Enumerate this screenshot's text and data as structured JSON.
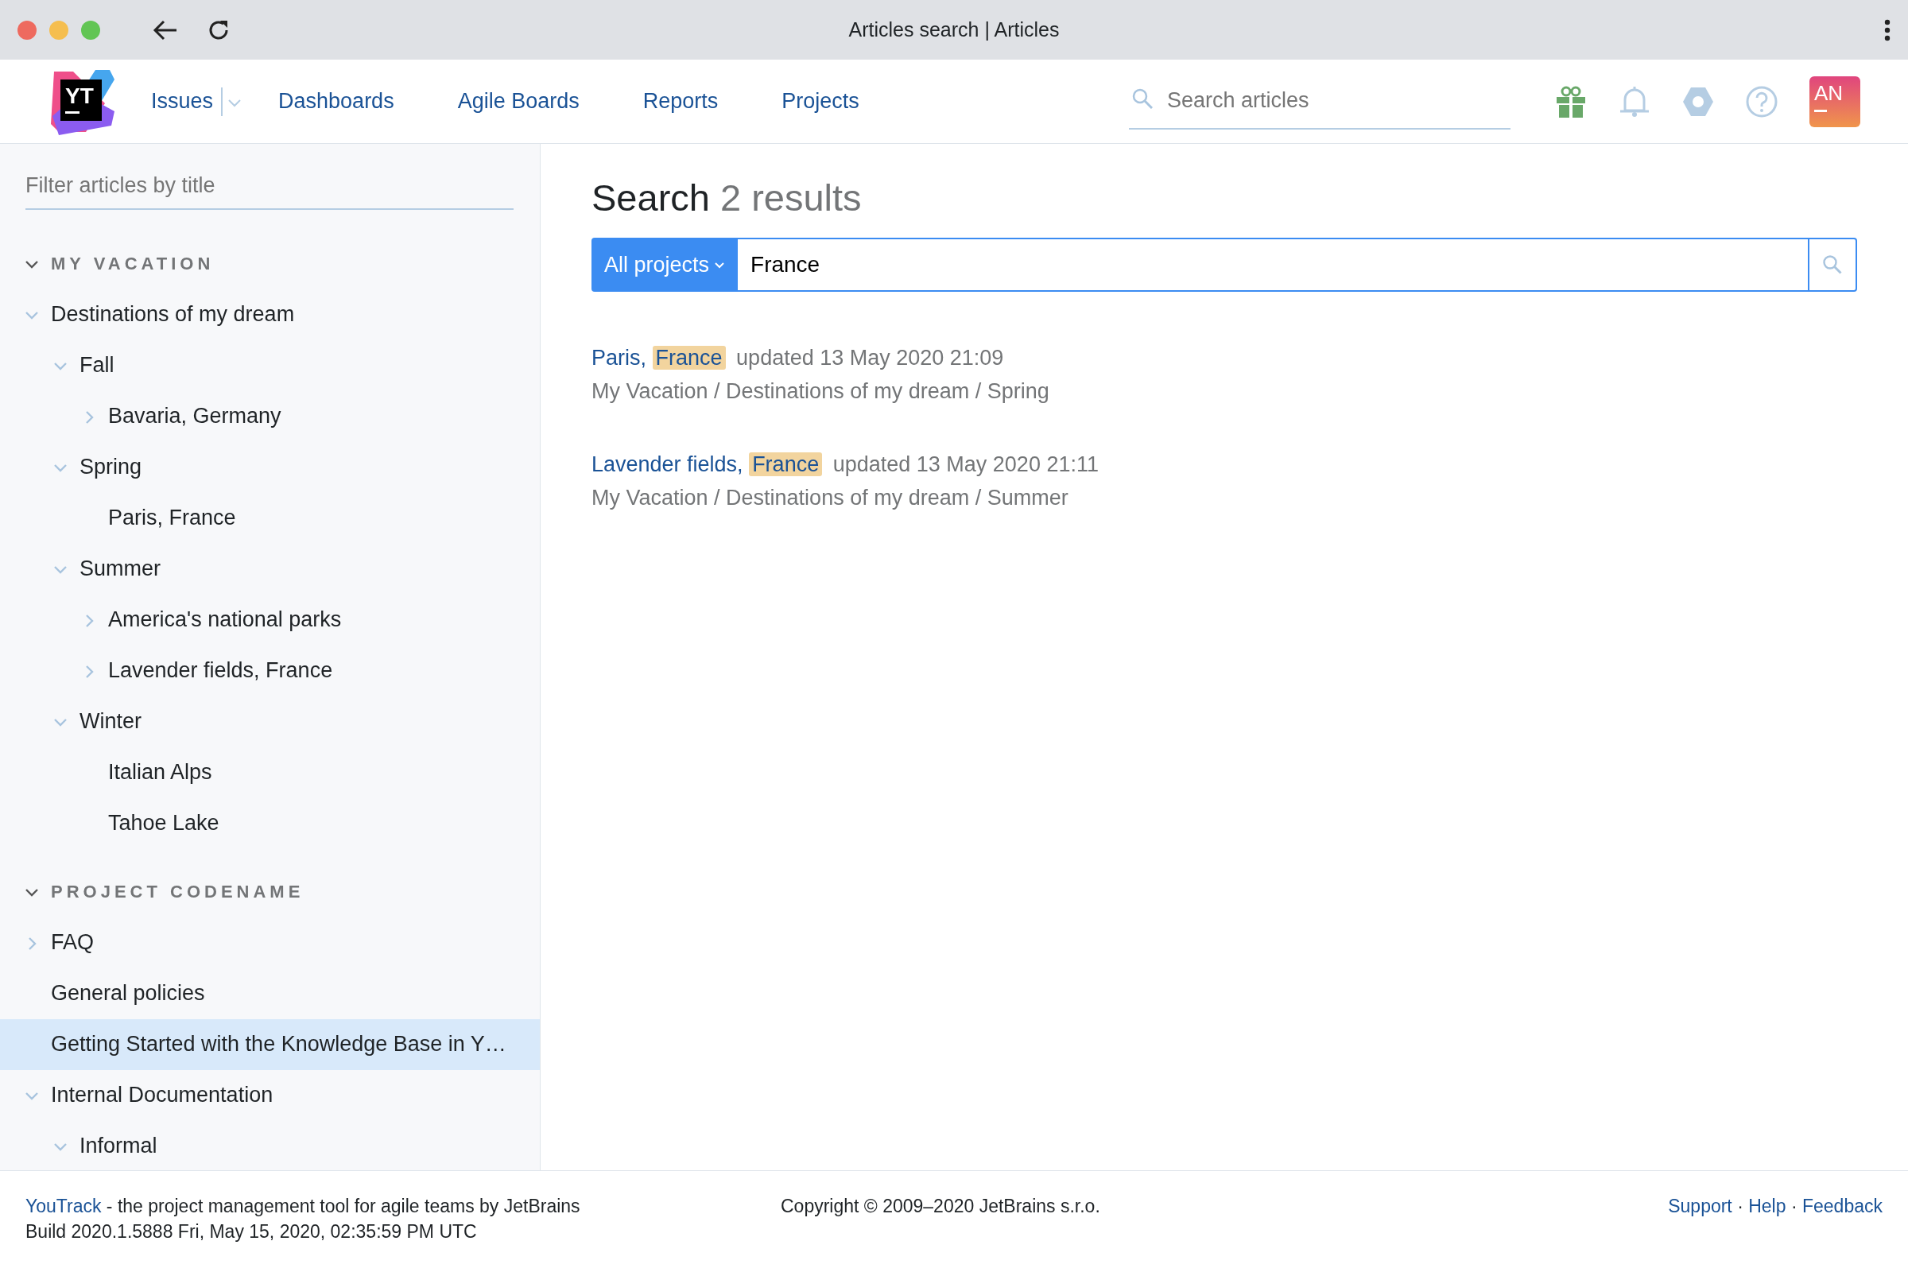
{
  "window": {
    "title": "Articles search | Articles"
  },
  "header": {
    "logo": "YT",
    "nav": [
      {
        "label": "Issues",
        "dropdown": true
      },
      {
        "label": "Dashboards",
        "dropdown": false
      },
      {
        "label": "Agile Boards",
        "dropdown": false
      },
      {
        "label": "Reports",
        "dropdown": false
      },
      {
        "label": "Projects",
        "dropdown": false
      }
    ],
    "search": {
      "placeholder": "Search articles"
    },
    "avatar": "AN"
  },
  "sidebar": {
    "filter": {
      "placeholder": "Filter articles by title"
    },
    "sections": [
      {
        "title": "MY VACATION",
        "expanded": true,
        "items": [
          {
            "label": "Destinations of my dream",
            "kind": "folder",
            "expanded": true,
            "selected": false,
            "children": [
              {
                "label": "Fall",
                "kind": "folder",
                "expanded": true,
                "selected": false,
                "children": [
                  {
                    "label": "Bavaria, Germany",
                    "kind": "folder",
                    "expanded": false,
                    "selected": false
                  }
                ]
              },
              {
                "label": "Spring",
                "kind": "folder",
                "expanded": true,
                "selected": false,
                "children": [
                  {
                    "label": "Paris, France",
                    "kind": "page",
                    "selected": false
                  }
                ]
              },
              {
                "label": "Summer",
                "kind": "folder",
                "expanded": true,
                "selected": false,
                "children": [
                  {
                    "label": "America's national parks",
                    "kind": "folder",
                    "expanded": false,
                    "selected": false
                  },
                  {
                    "label": "Lavender fields, France",
                    "kind": "folder",
                    "expanded": false,
                    "selected": false
                  }
                ]
              },
              {
                "label": "Winter",
                "kind": "folder",
                "expanded": true,
                "selected": false,
                "children": [
                  {
                    "label": "Italian Alps",
                    "kind": "page",
                    "selected": false
                  },
                  {
                    "label": "Tahoe Lake",
                    "kind": "page",
                    "selected": false
                  }
                ]
              }
            ]
          }
        ]
      },
      {
        "title": "PROJECT CODENAME",
        "expanded": true,
        "items": [
          {
            "label": "FAQ",
            "kind": "folder",
            "expanded": false,
            "selected": false
          },
          {
            "label": "General policies",
            "kind": "page",
            "selected": false
          },
          {
            "label": "Getting Started with the Knowledge Base in Y…",
            "kind": "page",
            "selected": true
          },
          {
            "label": "Internal Documentation",
            "kind": "folder",
            "expanded": true,
            "selected": false,
            "children": [
              {
                "label": "Informal",
                "kind": "folder",
                "expanded": true,
                "selected": false
              }
            ]
          }
        ]
      }
    ]
  },
  "main": {
    "heading": "Search",
    "count": "2 results",
    "scope": "All projects",
    "query": "France",
    "results": [
      {
        "title": "Paris,",
        "match": "France",
        "updated": "updated 13 May 2020 21:09",
        "path": "My Vacation / Destinations of my dream / Spring"
      },
      {
        "title": "Lavender fields,",
        "match": "France",
        "updated": "updated 13 May 2020 21:11",
        "path": "My Vacation / Destinations of my dream / Summer"
      }
    ]
  },
  "footer": {
    "brand": "YouTrack",
    "tagline": "- the project management tool for agile teams by JetBrains",
    "build": "Build 2020.1.5888 Fri, May 15, 2020, 02:35:59 PM UTC",
    "copyright": "Copyright © 2009–2020 JetBrains s.r.o.",
    "links": [
      "Support",
      "Help",
      "Feedback"
    ],
    "separator": "·"
  }
}
